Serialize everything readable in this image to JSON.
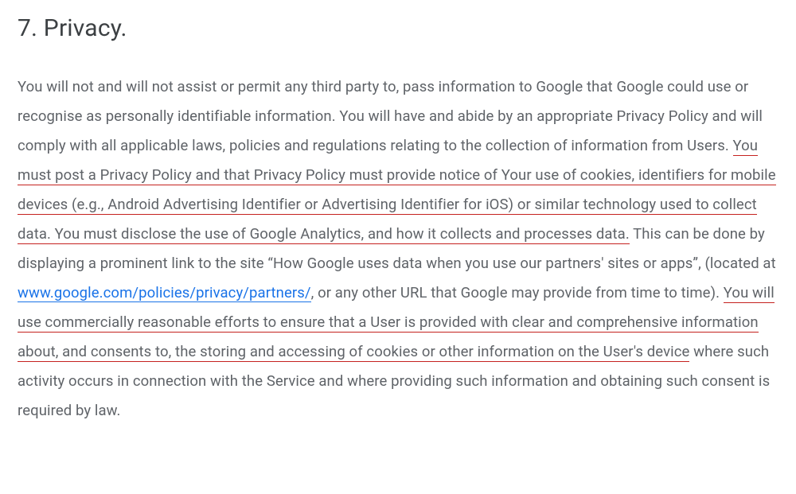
{
  "heading": "7. Privacy.",
  "para": {
    "t1": "You will not and will not assist or permit any third party to, pass information to Google that Google could use or recognise as personally identifiable information. You will have and abide by an appropriate Privacy Policy and will comply with all applicable laws, policies and regulations relating to the collection of information from Users. ",
    "u1": "You must post a Privacy Policy and that Privacy Policy must provide notice of Your use of cookies, identifiers for mobile devices (e.g., Android Advertising Identifier or Advertising Identifier for iOS) or similar technology used to collect data. You must disclose the use of Google Analytics, and how it collects and processes data.",
    "t2": " This can be done by displaying a prominent link to the site “How Google uses data when you use our partners' sites or apps”, (located at ",
    "link": "www.google.com/policies/privacy/partners/",
    "t3": ", or any other URL that Google may provide from time to time). ",
    "u2": "You will use commercially reasonable efforts to ensure that a User is provided with clear and comprehensive information about, and consents to, the storing and accessing of cookies or other information on the User's device",
    "t4": " where such activity occurs in connection with the Service and where providing such information and obtaining such consent is required by law."
  }
}
